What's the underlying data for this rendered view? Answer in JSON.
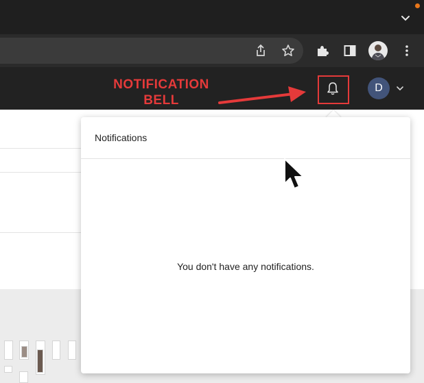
{
  "annotation": {
    "line1": "NOTIFICATION",
    "line2": "BELL",
    "color": "#e53a3a"
  },
  "header": {
    "avatar_initial": "D",
    "avatar_color": "#42547a"
  },
  "notifications_panel": {
    "title": "Notifications",
    "empty_message": "You don't have any notifications."
  },
  "browser_toolbar": {
    "icons": [
      "share-icon",
      "star-icon",
      "extensions-icon",
      "side-panel-icon",
      "profile-photo",
      "menu-icon"
    ]
  }
}
